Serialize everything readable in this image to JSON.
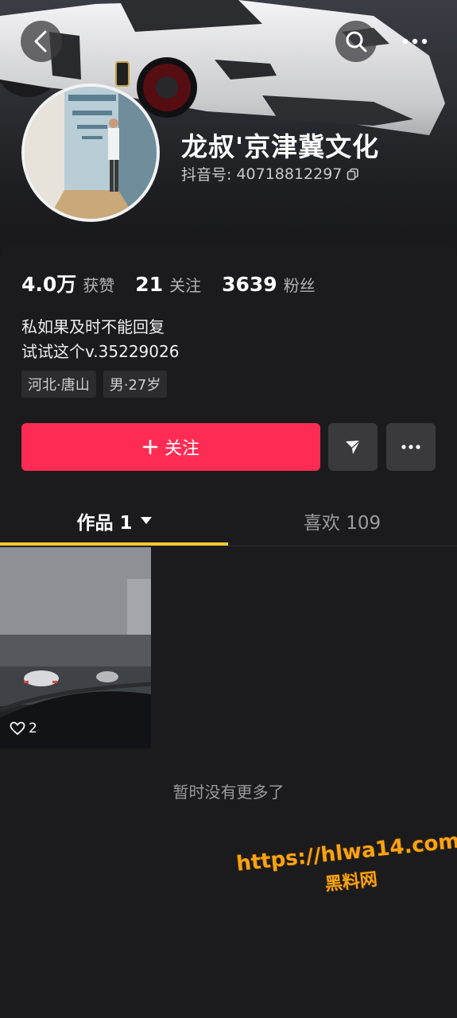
{
  "header": {
    "nickname": "龙叔'京津冀文化",
    "douyin_id_label": "抖音号:",
    "douyin_id": "40718812297",
    "back_icon": "chevron-left-icon",
    "search_icon": "search-icon",
    "more_icon": "more-horizontal-icon"
  },
  "stats": [
    {
      "value": "4.0万",
      "label": "获赞"
    },
    {
      "value": "21",
      "label": "关注"
    },
    {
      "value": "3639",
      "label": "粉丝"
    }
  ],
  "bio": {
    "line1": "私如果及时不能回复",
    "line2": "试试这个v.35229026"
  },
  "tags": [
    "河北·唐山",
    "男·27岁"
  ],
  "actions": {
    "follow_label": "关注",
    "follow_icon": "plus-icon",
    "share_icon": "send-icon",
    "more_icon": "more-horizontal-icon"
  },
  "tabs": {
    "works_label": "作品 1",
    "likes_label": "喜欢 109"
  },
  "video": {
    "likes_count": "2"
  },
  "footer": {
    "no_more_text": "暂时没有更多了"
  },
  "watermark": {
    "url": "https://hlwa14.com",
    "name": "黑料网"
  },
  "colors": {
    "accent": "#fe2c55",
    "tab_underline": "#fbc633",
    "background": "#1b1b1d"
  }
}
